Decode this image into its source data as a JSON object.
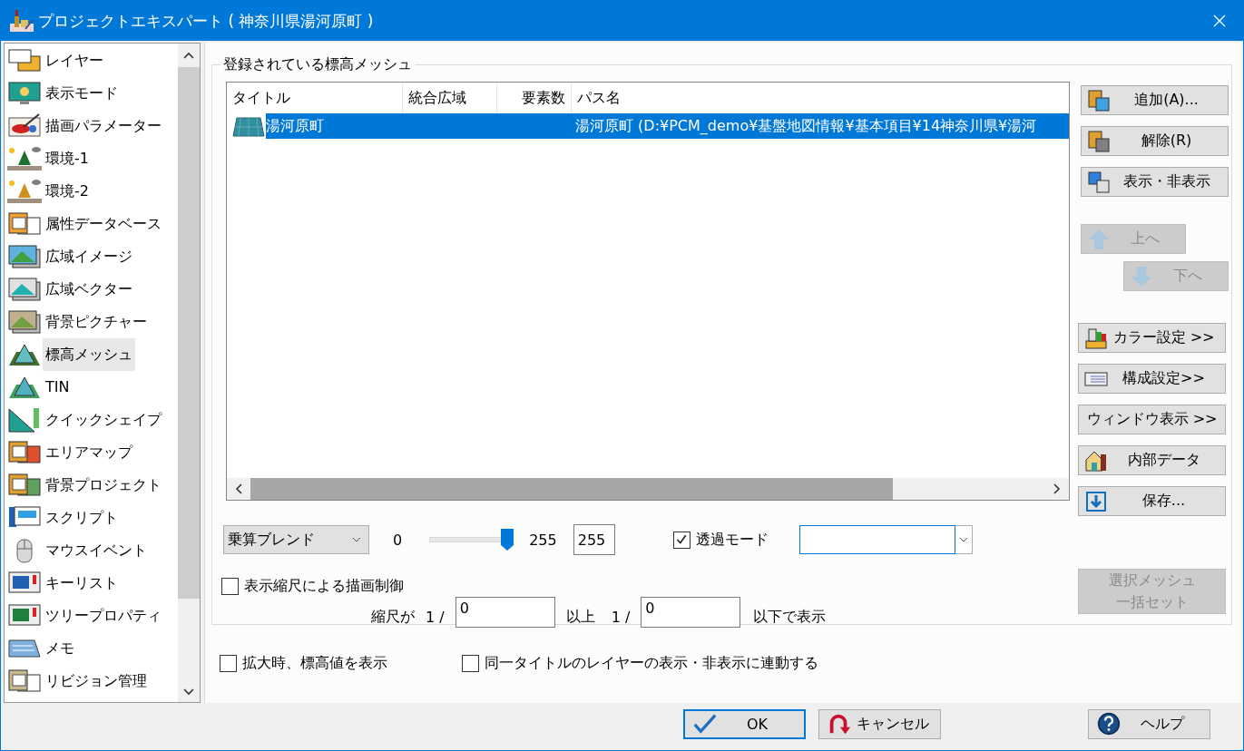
{
  "window": {
    "title": "プロジェクトエキスパート ( 神奈川県湯河原町 )"
  },
  "sidebar": {
    "items": [
      {
        "label": "レイヤー",
        "selected": false
      },
      {
        "label": "表示モード",
        "selected": false
      },
      {
        "label": "描画パラメーター",
        "selected": false
      },
      {
        "label": "環境-1",
        "selected": false
      },
      {
        "label": "環境-2",
        "selected": false
      },
      {
        "label": "属性データベース",
        "selected": false
      },
      {
        "label": "広域イメージ",
        "selected": false
      },
      {
        "label": "広域ベクター",
        "selected": false
      },
      {
        "label": "背景ピクチャー",
        "selected": false
      },
      {
        "label": "標高メッシュ",
        "selected": true
      },
      {
        "label": "TIN",
        "selected": false
      },
      {
        "label": "クイックシェイプ",
        "selected": false
      },
      {
        "label": "エリアマップ",
        "selected": false
      },
      {
        "label": "背景プロジェクト",
        "selected": false
      },
      {
        "label": "スクリプト",
        "selected": false
      },
      {
        "label": "マウスイベント",
        "selected": false
      },
      {
        "label": "キーリスト",
        "selected": false
      },
      {
        "label": "ツリープロパティ",
        "selected": false
      },
      {
        "label": "メモ",
        "selected": false
      },
      {
        "label": "リビジョン管理",
        "selected": false
      }
    ]
  },
  "mesh_group": {
    "title": "登録されている標高メッシュ",
    "table": {
      "columns": [
        "タイトル",
        "統合広域",
        "要素数",
        "パス名"
      ],
      "rows": [
        {
          "title": "湯河原町",
          "path": "湯河原町 (D:¥PCM_demo¥基盤地図情報¥基本項目¥14神奈川県¥湯河",
          "selected": true
        }
      ]
    },
    "blend": {
      "value": "乗算ブレンド"
    },
    "opacity": {
      "min": "0",
      "max": "255",
      "level": 1.0,
      "value": "255"
    },
    "transparent_mode": {
      "label": "透過モード",
      "checked": true
    },
    "scale_control": {
      "label": "表示縮尺による描画制御",
      "checked": false,
      "prefix": "縮尺が",
      "ratio_1": "1 /",
      "min_value": "0",
      "middle": "以上",
      "ratio_2": "1 /",
      "max_value": "0",
      "suffix": "以下で表示"
    },
    "side_buttons": [
      {
        "label": "追加(A)...",
        "disabled": false
      },
      {
        "label": "解除(R)",
        "disabled": false
      },
      {
        "label": "表示・非表示",
        "disabled": false
      },
      {
        "label": "上へ",
        "disabled": true
      },
      {
        "label": "下へ",
        "disabled": true
      },
      {
        "label": "カラー設定 >>",
        "disabled": false
      },
      {
        "label": "構成設定>>",
        "disabled": false
      },
      {
        "label": "ウィンドウ表示 >>",
        "disabled": false
      },
      {
        "label": "内部データ",
        "disabled": false
      },
      {
        "label": "保存...",
        "disabled": false
      },
      {
        "lines": [
          "選択メッシュ",
          "一括セット"
        ],
        "disabled": true
      }
    ]
  },
  "options": [
    {
      "label": "拡大時、標高値を表示",
      "checked": false
    },
    {
      "label": "同一タイトルのレイヤーの表示・非表示に連動する",
      "checked": false
    }
  ],
  "footer_buttons": [
    {
      "label": "OK",
      "default": true
    },
    {
      "label": "キャンセル",
      "default": false
    },
    {
      "label": "ヘルプ",
      "default": false
    }
  ]
}
